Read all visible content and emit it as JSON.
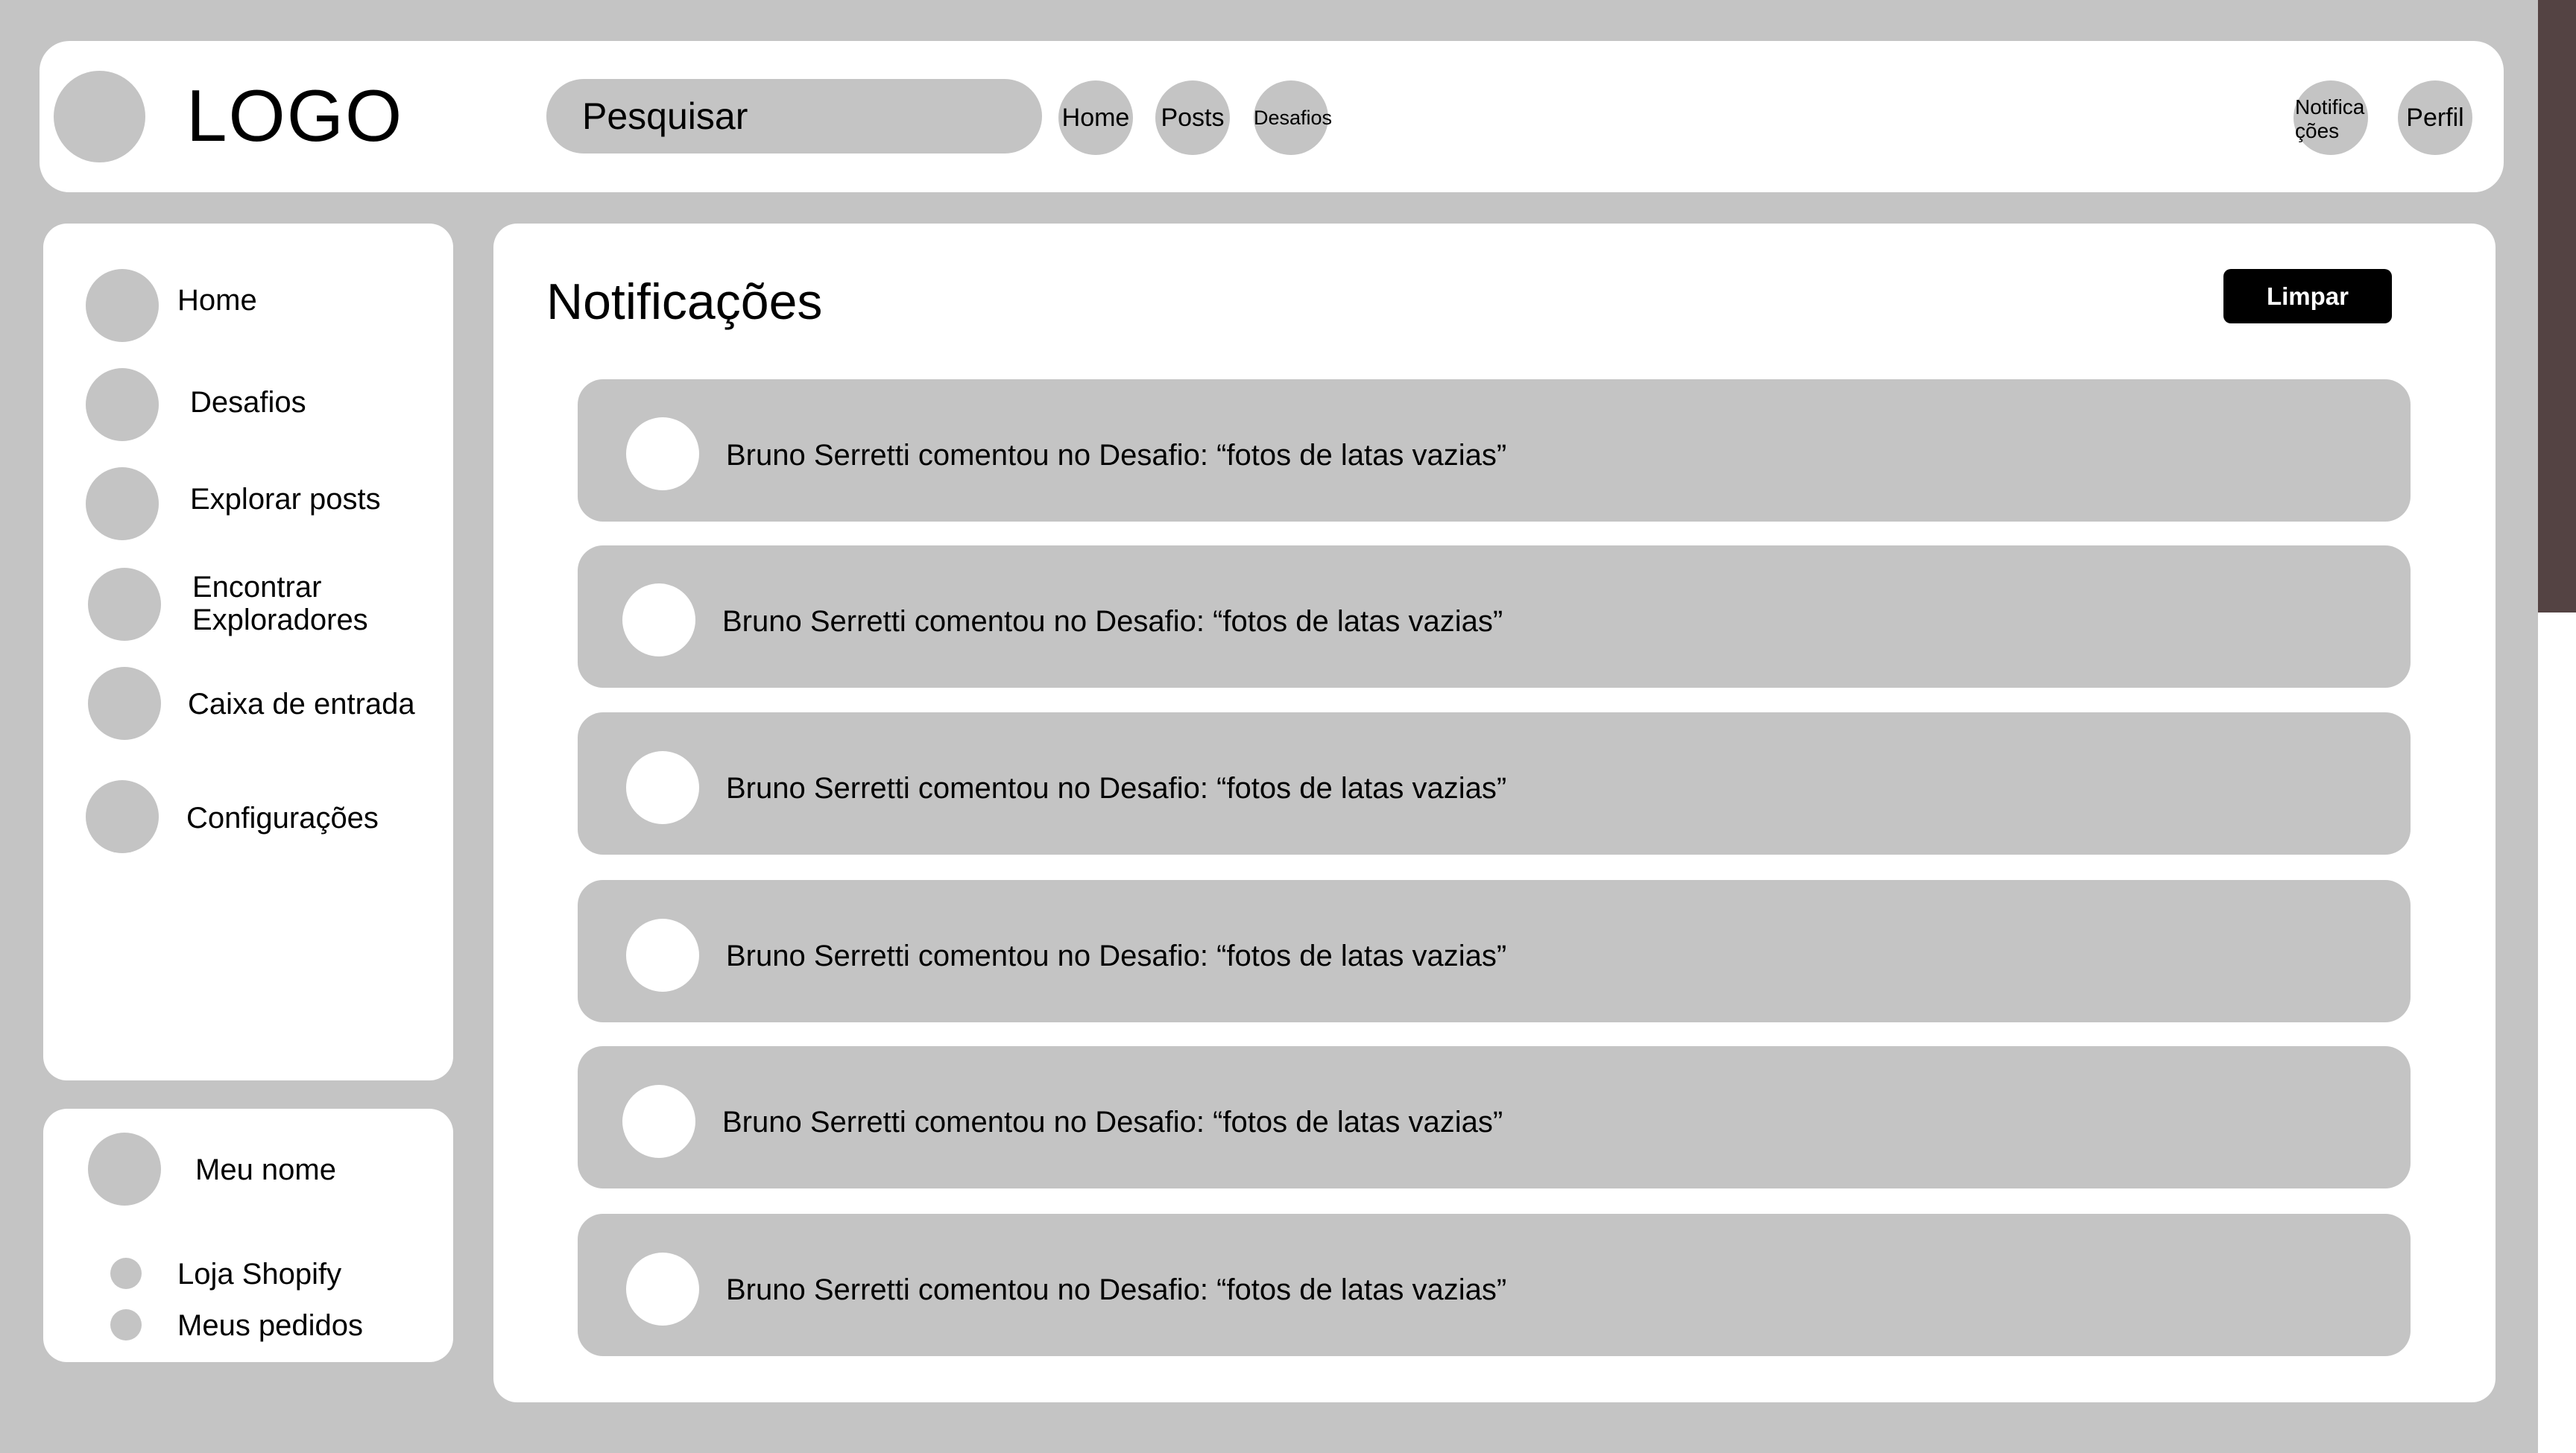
{
  "header": {
    "logo": "LOGO",
    "search_placeholder": "Pesquisar",
    "nav": [
      "Home",
      "Posts",
      "Desafios"
    ],
    "notifications_label": "Notifica ções",
    "profile_label": "Perfil"
  },
  "sidebar": {
    "items": [
      {
        "label": "Home"
      },
      {
        "label": "Desafios"
      },
      {
        "label": "Explorar posts"
      },
      {
        "label": "Encontrar Exploradores"
      },
      {
        "label": "Caixa de entrada"
      },
      {
        "label": "Configurações"
      }
    ]
  },
  "user": {
    "name": "Meu nome",
    "links": [
      "Loja Shopify",
      "Meus pedidos"
    ]
  },
  "main": {
    "title": "Notificações",
    "clear_label": "Limpar",
    "notifications": [
      "Bruno Serretti comentou no Desafio: “fotos de latas vazias”",
      "Bruno Serretti comentou no Desafio: “fotos de latas vazias”",
      "Bruno Serretti comentou no Desafio: “fotos de latas vazias”",
      "Bruno Serretti comentou no Desafio: “fotos de latas vazias”",
      "Bruno Serretti comentou no Desafio: “fotos de latas vazias”",
      "Bruno Serretti comentou no Desafio: “fotos de latas vazias”"
    ]
  },
  "colors": {
    "background": "#c4c4c4",
    "panel": "#ffffff",
    "button": "#000000",
    "scrollbar_thumb": "#544343"
  }
}
